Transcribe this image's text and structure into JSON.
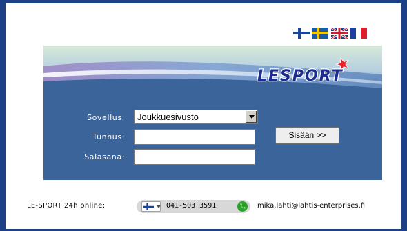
{
  "languages": [
    {
      "code": "fi",
      "icon": "finland-flag-icon"
    },
    {
      "code": "sv",
      "icon": "sweden-flag-icon"
    },
    {
      "code": "en",
      "icon": "uk-flag-icon"
    },
    {
      "code": "fr",
      "icon": "france-flag-icon"
    }
  ],
  "brand": {
    "logo_text": "LESPORT",
    "logo_color": "#1c2d8f",
    "star_color": "#e8202a"
  },
  "login": {
    "app_label": "Sovellus:",
    "app_selected": "Joukkuesivusto",
    "user_label": "Tunnus:",
    "user_value": "",
    "pass_label": "Salasana:",
    "pass_value": "",
    "submit_label": "Sisään >>"
  },
  "footer": {
    "label": "LE-SPORT 24h online:",
    "phone": "041-503 3591",
    "email": "mika.lahti@lahtis-enterprises.fi"
  },
  "colors": {
    "background": "#1d3f86",
    "box": "#3b649a",
    "call_icon": "#2aa52a"
  }
}
